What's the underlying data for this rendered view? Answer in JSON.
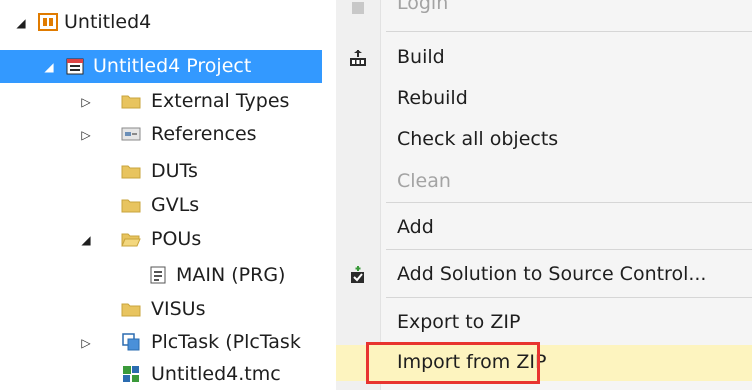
{
  "tree": {
    "items": [
      {
        "label": "Untitled4",
        "arrow": "◢",
        "icon": "twincat-solution-icon"
      },
      {
        "label": "Untitled4 Project",
        "arrow": "◢",
        "icon": "plc-project-icon"
      },
      {
        "label": "External Types",
        "arrow": "▷",
        "icon": "folder-icon"
      },
      {
        "label": "References",
        "arrow": "▷",
        "icon": "references-icon"
      },
      {
        "label": "DUTs",
        "arrow": "",
        "icon": "folder-icon"
      },
      {
        "label": "GVLs",
        "arrow": "",
        "icon": "folder-icon"
      },
      {
        "label": "POUs",
        "arrow": "◢",
        "icon": "folder-open-icon"
      },
      {
        "label": "MAIN (PRG)",
        "arrow": "",
        "icon": "program-icon"
      },
      {
        "label": "VISUs",
        "arrow": "",
        "icon": "folder-icon"
      },
      {
        "label": "PlcTask (PlcTask",
        "arrow": "▷",
        "icon": "task-icon"
      },
      {
        "label": "Untitled4.tmc",
        "arrow": "",
        "icon": "tmc-file-icon"
      }
    ]
  },
  "menu": {
    "items": [
      {
        "label": "Login",
        "disabled": true
      },
      {
        "label": "Build",
        "icon": "build-icon"
      },
      {
        "label": "Rebuild"
      },
      {
        "label": "Check all objects"
      },
      {
        "label": "Clean",
        "disabled": true
      },
      {
        "label": "Add"
      },
      {
        "label": "Add Solution to Source Control...",
        "icon": "source-control-icon"
      },
      {
        "label": "Export to ZIP"
      },
      {
        "label": "Import from ZIP",
        "highlighted": true
      }
    ]
  },
  "colors": {
    "selection": "#3399ff",
    "hover": "#fdf4bf",
    "highlight_border": "#e8342f",
    "folder": "#e8c45f"
  }
}
